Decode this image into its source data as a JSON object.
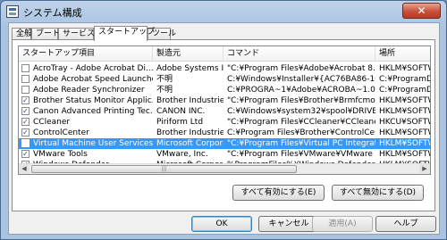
{
  "window": {
    "title": "システム構成",
    "close_label": "✕"
  },
  "tabs": [
    "全般",
    "ブート",
    "サービス",
    "スタートアップ",
    "ツール"
  ],
  "columns": [
    "スタートアップ項目",
    "製造元",
    "コマンド",
    "場所"
  ],
  "rows": [
    {
      "checked": false,
      "selected": false,
      "item": "AcroTray - Adobe Acrobat Di...",
      "maker": "Adobe Systems Inc.",
      "command": "\"C:¥Program Files¥Adobe¥Acrobat 8.0¥Acro...",
      "location": "HKLM¥SOFTW..."
    },
    {
      "checked": false,
      "selected": false,
      "item": "Adobe Acrobat Speed Launcher",
      "maker": "不明",
      "command": "C:¥Windows¥Installer¥{AC76BA86-1041-0...",
      "location": "C:¥ProgramDat..."
    },
    {
      "checked": false,
      "selected": false,
      "item": "Adobe Reader Synchronizer",
      "maker": "不明",
      "command": "C:¥PROGRA~1¥Adobe¥ACROBA~1.0¥Acro...",
      "location": "C:¥ProgramDat..."
    },
    {
      "checked": true,
      "selected": false,
      "item": "Brother Status Monitor Applic...",
      "maker": "Brother Industries,...",
      "command": "\"C:¥Program Files¥Brother¥Brmfcmon¥BrM...",
      "location": "HKLM¥SOFTW..."
    },
    {
      "checked": true,
      "selected": false,
      "item": "Canon Advanced Printing Tec...",
      "maker": "CANON INC.",
      "command": "C:¥Windows¥system32¥spool¥DRIVERS¥...",
      "location": "HKLM¥SOFTW..."
    },
    {
      "checked": true,
      "selected": false,
      "item": "CCleaner",
      "maker": "Piriform Ltd",
      "command": "\"C:¥Program Files¥CCleaner¥CCleaner.ex...",
      "location": "HKCU¥SOFTW..."
    },
    {
      "checked": true,
      "selected": false,
      "item": "ControlCenter",
      "maker": "Brother Industries,...",
      "command": "C:¥Program Files¥Brother¥ControlCenter3...",
      "location": "HKLM¥SOFTW..."
    },
    {
      "checked": false,
      "selected": true,
      "item": "Virtual Machine User Services",
      "maker": "Microsoft Corporat...",
      "command": "\"C:¥Program Files¥Virtual PC Integration C...",
      "location": "HKLM¥SOFTW..."
    },
    {
      "checked": true,
      "selected": false,
      "item": "VMware Tools",
      "maker": "VMware, Inc.",
      "command": "\"C:¥Program Files¥VMware¥VMware Tool...",
      "location": "HKLM¥SOFTW..."
    },
    {
      "checked": true,
      "selected": false,
      "item": "Windows Defender",
      "maker": "Microsoft Corporat...",
      "command": "%ProgramFiles%¥Windows Defender¥MSAS...",
      "location": "HKLM¥SOFTW..."
    }
  ],
  "scrollbar": {
    "left_arrow": "◀",
    "right_arrow": "▶",
    "grip": "|||"
  },
  "buttons": {
    "enable_all": "すべて有効にする(E)",
    "disable_all": "すべて無効にする(D)",
    "ok": "OK",
    "cancel": "キャンセル",
    "apply": "適用(A)",
    "help": "ヘルプ"
  }
}
